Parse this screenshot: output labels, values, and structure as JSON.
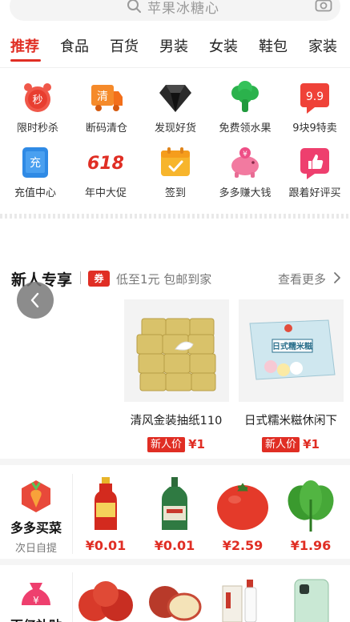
{
  "search": {
    "placeholder": "苹果冰糖心"
  },
  "tabs": [
    "推荐",
    "食品",
    "百货",
    "男装",
    "女装",
    "鞋包",
    "家装"
  ],
  "categories": [
    {
      "label": "限时秒杀",
      "icon": "flash-sale-clock-icon",
      "glyph": "秒"
    },
    {
      "label": "断码清仓",
      "icon": "clearance-truck-icon",
      "glyph": "清"
    },
    {
      "label": "发现好货",
      "icon": "diamond-icon"
    },
    {
      "label": "免费领水果",
      "icon": "broccoli-icon"
    },
    {
      "label": "9块9特卖",
      "icon": "nine-nine-sale-icon",
      "glyph": "9.9"
    },
    {
      "label": "充值中心",
      "icon": "phone-recharge-icon",
      "glyph": "充"
    },
    {
      "label": "年中大促",
      "icon": "618-promo-icon",
      "glyph": "618"
    },
    {
      "label": "签到",
      "icon": "calendar-checkin-icon"
    },
    {
      "label": "多多赚大钱",
      "icon": "piggy-bank-icon",
      "glyph": "¥"
    },
    {
      "label": "跟着好评买",
      "icon": "thumbs-up-icon"
    }
  ],
  "new_user": {
    "title": "新人专享",
    "coupon": "券",
    "subtitle": "低至1元 包邮到家",
    "more": "查看更多",
    "products": [
      {
        "name": "清风金装抽纸110",
        "tag": "新人价",
        "price": "¥1"
      },
      {
        "name": "日式糯米糍休闲下",
        "tag": "新人价",
        "price": "¥1",
        "box_title": "日式糯米糍"
      }
    ]
  },
  "grocery": {
    "title": "多多买菜",
    "subtitle": "次日自提",
    "items": [
      {
        "name": "bottled-drink",
        "price": "¥0.01"
      },
      {
        "name": "green-bottle",
        "price": "¥0.01"
      },
      {
        "name": "tomato",
        "price": "¥2.59"
      },
      {
        "name": "spinach",
        "price": "¥1.96"
      }
    ]
  },
  "subsidy": {
    "title": "百亿补贴",
    "glyph": "¥"
  },
  "colors": {
    "accent": "#e02e24",
    "muted": "#777777"
  }
}
